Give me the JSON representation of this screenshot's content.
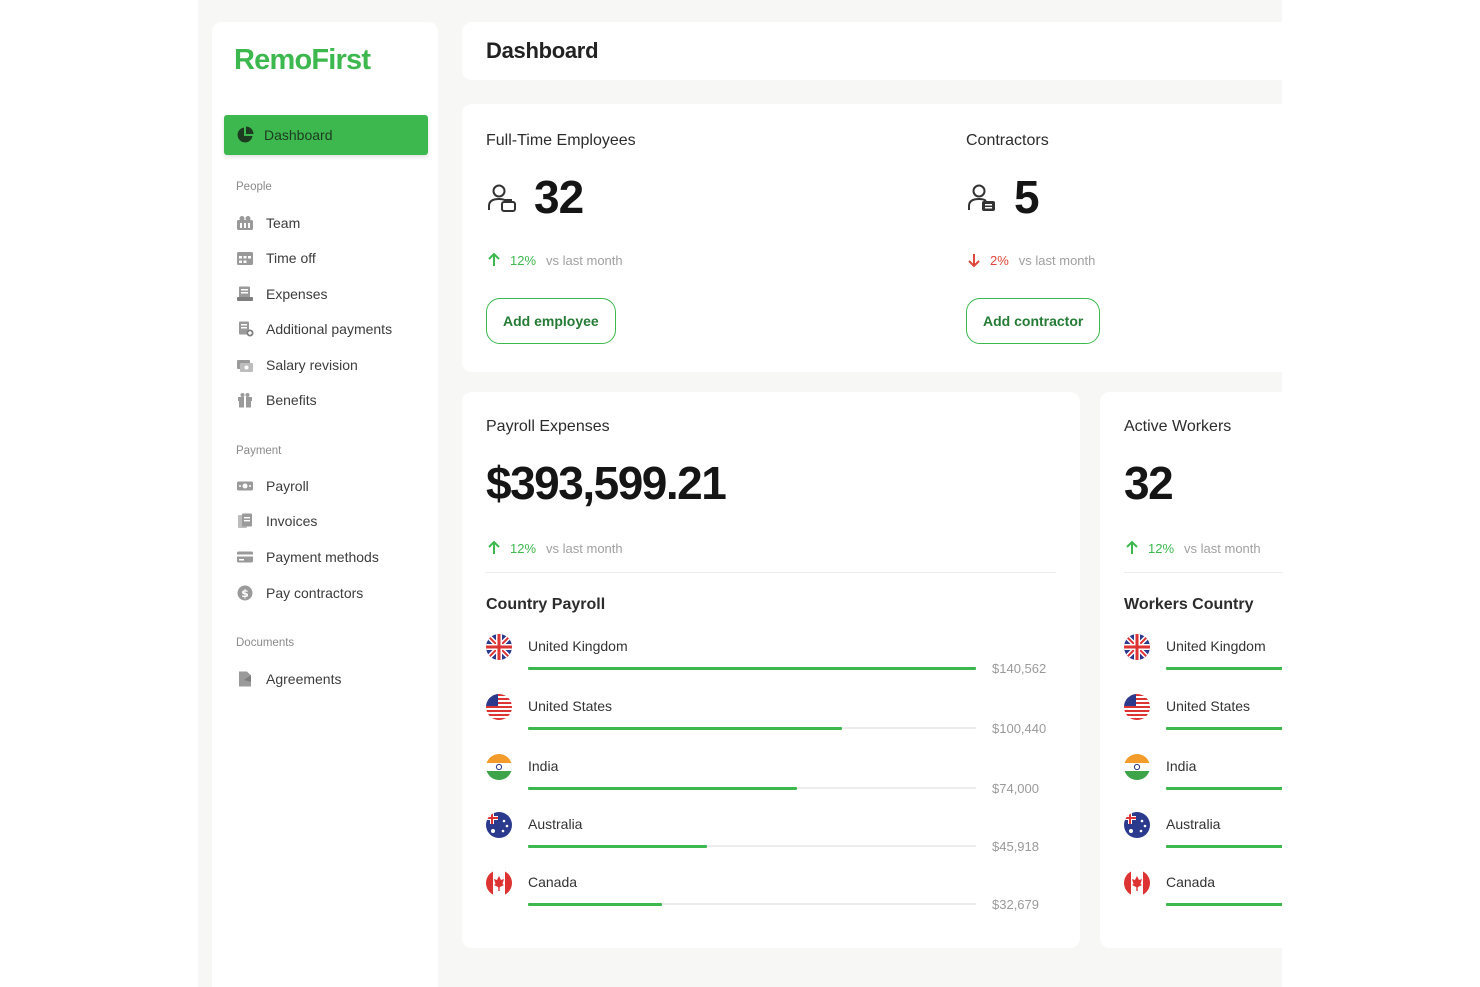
{
  "brand": {
    "name": "RemoFirst",
    "color": "#3db84f"
  },
  "header": {
    "title": "Dashboard"
  },
  "sidebar": {
    "active": {
      "label": "Dashboard",
      "icon": "pie-chart-icon"
    },
    "sections": [
      {
        "label": "People",
        "items": [
          {
            "label": "Team",
            "icon": "team-icon"
          },
          {
            "label": "Time off",
            "icon": "calendar-icon"
          },
          {
            "label": "Expenses",
            "icon": "receipt-icon"
          },
          {
            "label": "Additional payments",
            "icon": "receipt-plus-icon"
          },
          {
            "label": "Salary revision",
            "icon": "salary-icon"
          },
          {
            "label": "Benefits",
            "icon": "gift-icon"
          }
        ]
      },
      {
        "label": "Payment",
        "items": [
          {
            "label": "Payroll",
            "icon": "cash-icon"
          },
          {
            "label": "Invoices",
            "icon": "invoice-icon"
          },
          {
            "label": "Payment methods",
            "icon": "card-icon"
          },
          {
            "label": "Pay contractors",
            "icon": "dollar-coin-icon"
          }
        ]
      },
      {
        "label": "Documents",
        "items": [
          {
            "label": "Agreements",
            "icon": "document-icon"
          }
        ]
      }
    ]
  },
  "metrics": {
    "employees": {
      "label": "Full-Time Employees",
      "value": "32",
      "change": "12%",
      "direction": "up",
      "vs": "vs last month",
      "button": "Add employee"
    },
    "contractors": {
      "label": "Contractors",
      "value": "5",
      "change": "2%",
      "direction": "down",
      "vs": "vs last month",
      "button": "Add contractor"
    }
  },
  "payroll": {
    "label": "Payroll Expenses",
    "value": "$393,599.21",
    "change": "12%",
    "vs": "vs last month",
    "country_title": "Country Payroll",
    "countries": [
      {
        "name": "United Kingdom",
        "amount": "$140,562",
        "fraction": 1.0,
        "flag": "uk"
      },
      {
        "name": "United States",
        "amount": "$100,440",
        "fraction": 0.7,
        "flag": "us"
      },
      {
        "name": "India",
        "amount": "$74,000",
        "fraction": 0.6,
        "flag": "in"
      },
      {
        "name": "Australia",
        "amount": "$45,918",
        "fraction": 0.4,
        "flag": "au"
      },
      {
        "name": "Canada",
        "amount": "$32,679",
        "fraction": 0.3,
        "flag": "ca"
      }
    ]
  },
  "workers": {
    "label": "Active Workers",
    "value": "32",
    "change": "12%",
    "vs": "vs last month",
    "country_title": "Workers Country",
    "countries": [
      {
        "name": "United Kingdom",
        "flag": "uk"
      },
      {
        "name": "United States",
        "flag": "us"
      },
      {
        "name": "India",
        "flag": "in"
      },
      {
        "name": "Australia",
        "flag": "au"
      },
      {
        "name": "Canada",
        "flag": "ca"
      }
    ]
  },
  "colors": {
    "up": "#3db84f",
    "down": "#e0473d",
    "muted": "#a0a0a0"
  }
}
